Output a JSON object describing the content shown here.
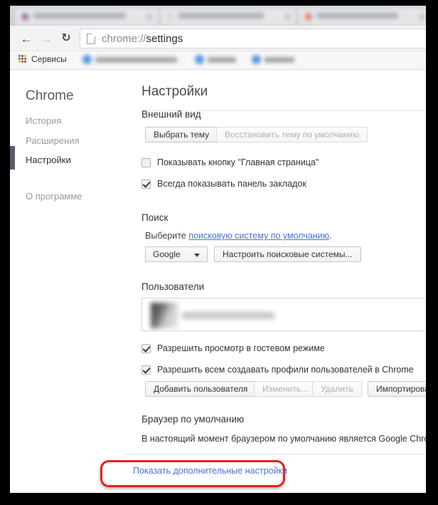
{
  "browser": {
    "tabs": [
      {
        "title": "",
        "blurred": true
      },
      {
        "title": "",
        "blurred": true
      },
      {
        "title": "",
        "blurred": true
      }
    ],
    "toolbar": {
      "back_icon": "arrow-left-icon",
      "forward_icon": "arrow-right-icon",
      "reload_icon": "reload-icon",
      "url_prefix": "chrome://",
      "url_page": "settings",
      "page_icon": "page-document-icon"
    },
    "bookmarks_bar": {
      "apps_label": "Сервисы",
      "apps_icon": "apps-grid-icon",
      "apps_icon_colors": [
        "#4285f4",
        "#ea4335",
        "#fbbc05",
        "#34a853",
        "#ea4335",
        "#4285f4",
        "#fbbc05",
        "#34a853",
        "#ea4335"
      ],
      "items": [
        {
          "label": "",
          "blurred": true
        },
        {
          "label": "",
          "blurred": true
        },
        {
          "label": "",
          "blurred": true
        }
      ]
    }
  },
  "sidebar": {
    "brand": "Chrome",
    "items": [
      {
        "label": "История",
        "active": false
      },
      {
        "label": "Расширения",
        "active": false
      },
      {
        "label": "Настройки",
        "active": true
      },
      {
        "label": "О программе",
        "active": false
      }
    ]
  },
  "main": {
    "title": "Настройки",
    "appearance": {
      "heading": "Внешний вид",
      "choose_theme_button": "Выбрать тему",
      "reset_theme_button": "Восстановить тему по умолчанию",
      "reset_theme_disabled": true,
      "checkbox_home_button": {
        "label": "Показывать кнопку \"Главная страница\"",
        "checked": false
      },
      "checkbox_bookmarks_bar": {
        "label": "Всегда показывать панель закладок",
        "checked": true
      }
    },
    "search": {
      "heading": "Поиск",
      "hint_prefix": "Выберите ",
      "hint_link": "поисковую систему по умолчанию",
      "hint_suffix": ".",
      "engine_selected": "Google",
      "manage_button": "Настроить поисковые системы..."
    },
    "users": {
      "heading": "Пользователи",
      "profile_row_blurred": true,
      "checkbox_guest": {
        "label": "Разрешить просмотр в гостевом режиме",
        "checked": true
      },
      "checkbox_create_profiles": {
        "label": "Разрешить всем создавать профили пользователей в Chrome",
        "checked": true
      },
      "buttons": [
        {
          "label": "Добавить пользователя",
          "disabled": false
        },
        {
          "label": "Изменить...",
          "disabled": true
        },
        {
          "label": "Удалить",
          "disabled": true
        },
        {
          "label": "Импортировать...",
          "disabled": false
        }
      ]
    },
    "default_browser": {
      "heading": "Браузер по умолчанию",
      "status": "В настоящий момент браузером по умолчанию является Google Chrome."
    },
    "advanced_link": "Показать дополнительные настройки"
  },
  "annotation": {
    "color": "#e8201a",
    "target": "advanced-settings-link"
  }
}
